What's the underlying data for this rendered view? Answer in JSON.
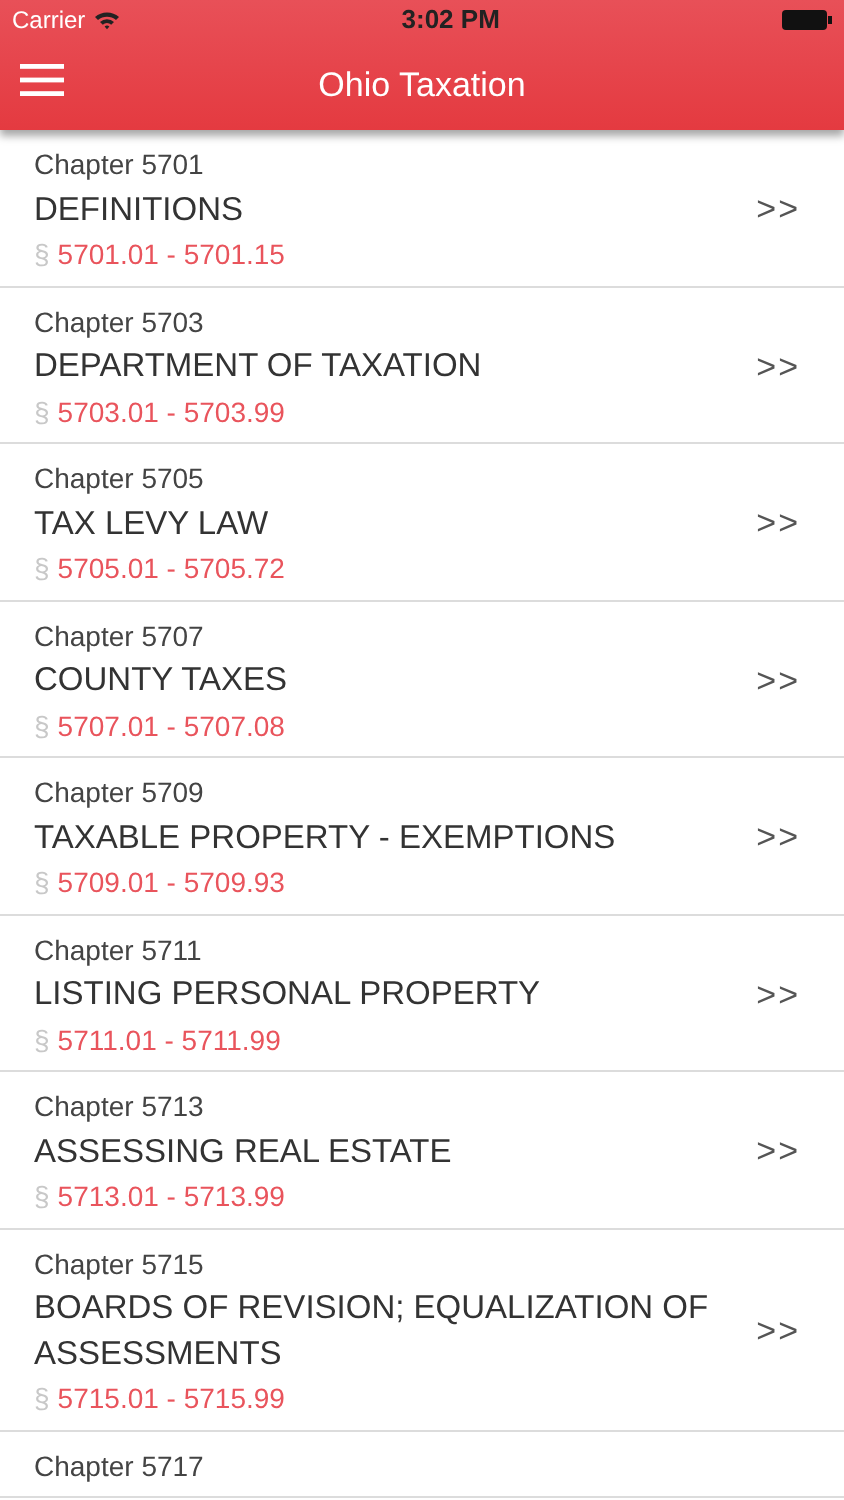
{
  "status_bar": {
    "carrier": "Carrier",
    "time": "3:02 PM"
  },
  "nav_bar": {
    "title": "Ohio Taxation"
  },
  "chapters": [
    {
      "chapter": "Chapter 5701",
      "title": "DEFINITIONS",
      "section_sign": "§",
      "range": "5701.01 - 5701.15",
      "chevron": ">>"
    },
    {
      "chapter": "Chapter 5703",
      "title": "DEPARTMENT OF TAXATION",
      "section_sign": "§",
      "range": "5703.01 - 5703.99",
      "chevron": ">>"
    },
    {
      "chapter": "Chapter 5705",
      "title": "TAX LEVY LAW",
      "section_sign": "§",
      "range": "5705.01 - 5705.72",
      "chevron": ">>"
    },
    {
      "chapter": "Chapter 5707",
      "title": "COUNTY TAXES",
      "section_sign": "§",
      "range": "5707.01 - 5707.08",
      "chevron": ">>"
    },
    {
      "chapter": "Chapter 5709",
      "title": "TAXABLE PROPERTY - EXEMPTIONS",
      "section_sign": "§",
      "range": "5709.01 - 5709.93",
      "chevron": ">>"
    },
    {
      "chapter": "Chapter 5711",
      "title": "LISTING PERSONAL PROPERTY",
      "section_sign": "§",
      "range": "5711.01 - 5711.99",
      "chevron": ">>"
    },
    {
      "chapter": "Chapter 5713",
      "title": "ASSESSING REAL ESTATE",
      "section_sign": "§",
      "range": "5713.01 - 5713.99",
      "chevron": ">>"
    },
    {
      "chapter": "Chapter 5715",
      "title": "BOARDS OF REVISION; EQUALIZATION OF ASSESSMENTS",
      "section_sign": "§",
      "range": "5715.01 - 5715.99",
      "chevron": ">>"
    },
    {
      "chapter": "Chapter 5717"
    }
  ]
}
